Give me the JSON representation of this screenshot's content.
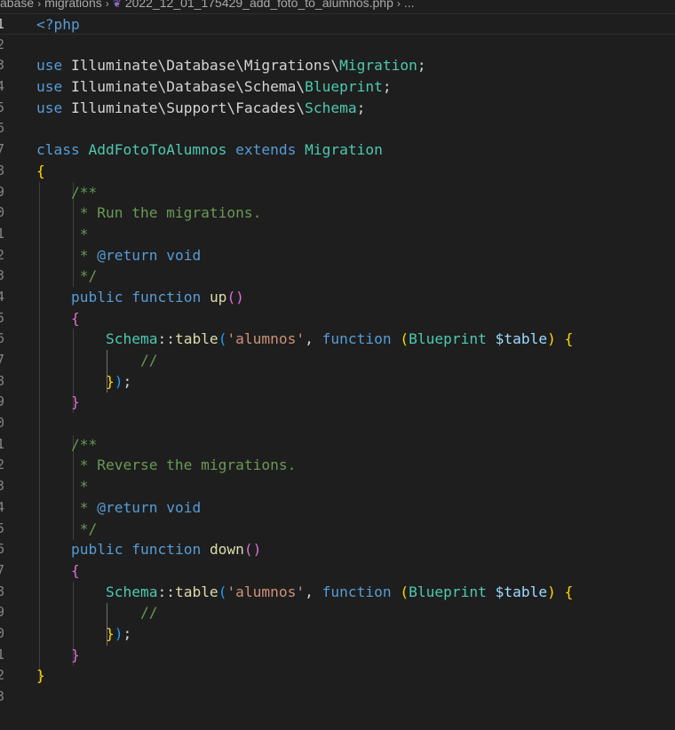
{
  "breadcrumb": {
    "segments": [
      "abase",
      "migrations"
    ],
    "file": "2022_12_01_175429_add_foto_to_alumnos.php",
    "more": "..."
  },
  "editor": {
    "language": "php",
    "line_numbers": [
      "1",
      "2",
      "3",
      "4",
      "5",
      "6",
      "7",
      "8",
      "9",
      "0",
      "1",
      "2",
      "3",
      "4",
      "5",
      "6",
      "7",
      "8",
      "9",
      "0",
      "1",
      "2",
      "3",
      "4",
      "5",
      "6",
      "7",
      "8",
      "9",
      "0",
      "1",
      "2",
      "3"
    ],
    "code": {
      "open_tag": "<?php",
      "use": "use",
      "use1_path": "Illuminate\\Database\\Migrations\\",
      "use1_cls": "Migration",
      "use2_path": "Illuminate\\Database\\Schema\\",
      "use2_cls": "Blueprint",
      "use3_path": "Illuminate\\Support\\Facades\\",
      "use3_cls": "Schema",
      "class_kw": "class",
      "class_name": "AddFotoToAlumnos",
      "extends_kw": "extends",
      "parent": "Migration",
      "doc_open": "/**",
      "doc_up": " * Run the migrations.",
      "doc_star": " *",
      "doc_return_prefix": " * ",
      "doc_return_tag": "@return",
      "doc_return_type": "void",
      "doc_close": " */",
      "public_kw": "public",
      "function_kw": "function",
      "up_name": "up",
      "schema": "Schema",
      "table_method": "table",
      "table_name": "'alumnos'",
      "blueprint": "Blueprint",
      "table_var": "$table",
      "comment": "//",
      "doc_down": " * Reverse the migrations.",
      "down_name": "down"
    }
  }
}
